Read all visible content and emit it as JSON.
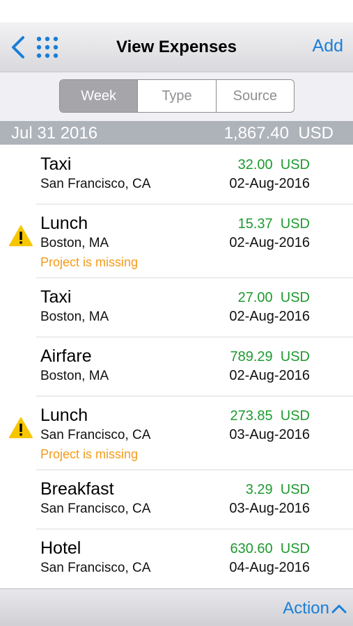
{
  "navbar": {
    "title": "View Expenses",
    "add_label": "Add",
    "back_icon": "chevron-left-icon",
    "grid_icon": "grid-icon"
  },
  "segments": [
    {
      "label": "Week",
      "active": true
    },
    {
      "label": "Type",
      "active": false
    },
    {
      "label": "Source",
      "active": false
    }
  ],
  "section": {
    "date": "Jul 31 2016",
    "total": "1,867.40  USD"
  },
  "expenses": [
    {
      "name": "Taxi",
      "location": "San Francisco, CA",
      "amount": "32.00  USD",
      "date": "02-Aug-2016",
      "warning": ""
    },
    {
      "name": "Lunch",
      "location": "Boston, MA",
      "amount": "15.37  USD",
      "date": "02-Aug-2016",
      "warning": "Project is missing"
    },
    {
      "name": "Taxi",
      "location": "Boston, MA",
      "amount": "27.00  USD",
      "date": "02-Aug-2016",
      "warning": ""
    },
    {
      "name": "Airfare",
      "location": "Boston, MA",
      "amount": "789.29  USD",
      "date": "02-Aug-2016",
      "warning": ""
    },
    {
      "name": "Lunch",
      "location": "San Francisco, CA",
      "amount": "273.85  USD",
      "date": "03-Aug-2016",
      "warning": "Project is missing"
    },
    {
      "name": "Breakfast",
      "location": "San Francisco, CA",
      "amount": "3.29  USD",
      "date": "03-Aug-2016",
      "warning": ""
    },
    {
      "name": "Hotel",
      "location": "San Francisco, CA",
      "amount": "630.60  USD",
      "date": "04-Aug-2016",
      "warning": ""
    }
  ],
  "toolbar": {
    "action_label": "Action",
    "action_icon": "chevron-up-icon"
  },
  "colors": {
    "accent": "#1a7ed6",
    "amount": "#1e9a2f",
    "warning": "#f39b19",
    "warning_icon": "#f7c600",
    "section_header": "#aeb3ba"
  }
}
